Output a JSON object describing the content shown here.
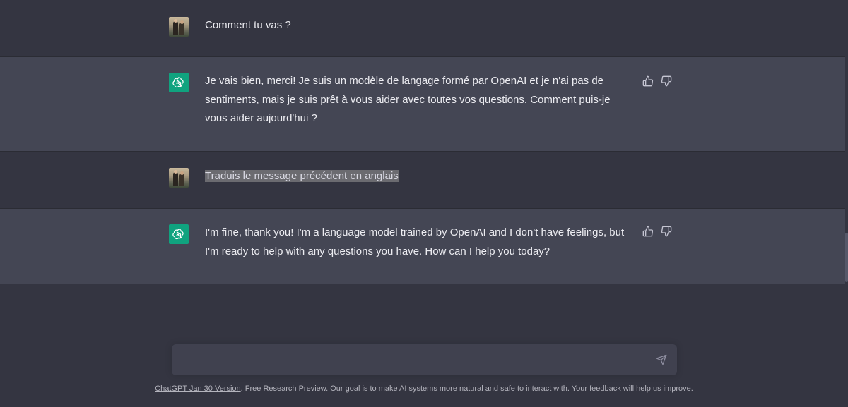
{
  "conversation": {
    "messages": [
      {
        "role": "user",
        "text": "Comment tu vas ?"
      },
      {
        "role": "assistant",
        "text": "Je vais bien, merci! Je suis un modèle de langage formé par OpenAI et je n'ai pas de sentiments, mais je suis prêt à vous aider avec toutes vos questions. Comment puis-je vous aider aujourd'hui ?"
      },
      {
        "role": "user",
        "text": "Traduis le message précédent en anglais"
      },
      {
        "role": "assistant",
        "text": "I'm fine, thank you! I'm a language model trained by OpenAI and I don't have feelings, but I'm ready to help with any questions you have. How can I help you today?"
      }
    ]
  },
  "input": {
    "value": "",
    "placeholder": ""
  },
  "footer": {
    "version_link": "ChatGPT Jan 30 Version",
    "text": ". Free Research Preview. Our goal is to make AI systems more natural and safe to interact with. Your feedback will help us improve."
  },
  "icons": {
    "user_avatar": "user-photo-avatar",
    "assistant_avatar": "openai-logo-icon",
    "thumbs_up": "thumbs-up-icon",
    "thumbs_down": "thumbs-down-icon",
    "send": "send-icon"
  },
  "colors": {
    "background": "#343541",
    "assistant_background": "#444654",
    "brand_green": "#10a37f",
    "input_background": "#40414f"
  }
}
